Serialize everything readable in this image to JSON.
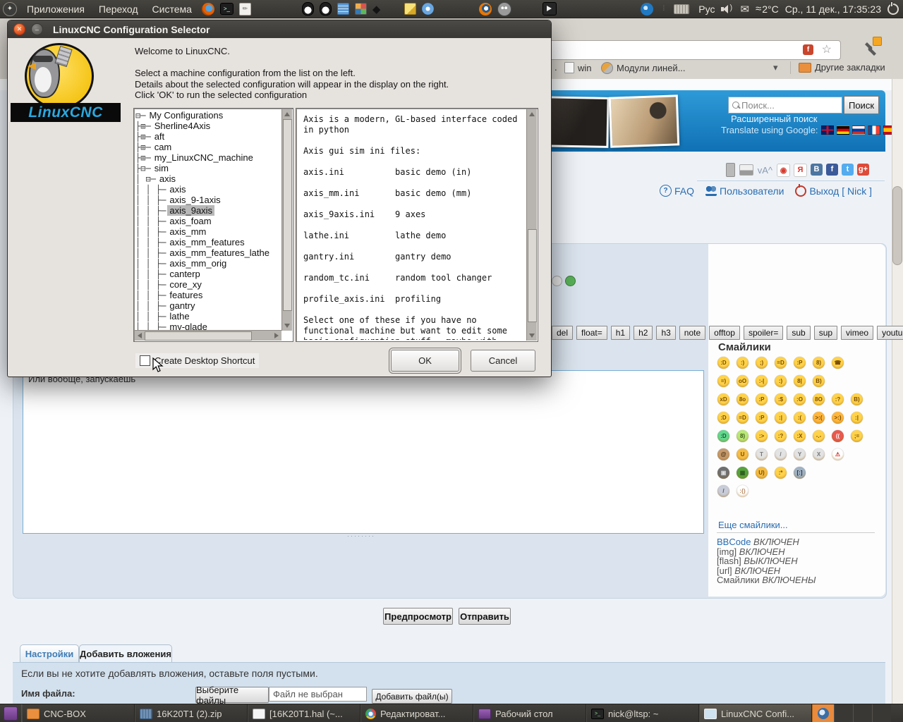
{
  "colors": {
    "accent_blue": "#1071b4",
    "link_blue": "#2a6db0",
    "panel_dark": "#3c3b37",
    "selection_gray": "#b8b8b8"
  },
  "icons": {
    "star": "☆",
    "caret": "▾",
    "envelope": "✉",
    "approx": "≈",
    "inkscape_diamond": "◆",
    "dots": "⁞",
    "text_size": "vA^",
    "question": "?",
    "flash": "f",
    "terminal_prompt": ">_",
    "gedit_pencil": "✏",
    "distro": "✦",
    "bookmarks_dot": "."
  },
  "top_panel": {
    "menus": [
      "Приложения",
      "Переход",
      "Система"
    ],
    "lang": "Рус",
    "temp": "2°C",
    "clock": "Ср., 11 дек., 17:35:23"
  },
  "dialog": {
    "title": "LinuxCNC Configuration Selector",
    "logo_text": "LinuxCNC",
    "welcome_lines": [
      "Welcome to LinuxCNC.",
      "",
      "Select a machine configuration from the list on the left.",
      "Details about the selected configuration will appear in the display on the right.",
      "Click 'OK' to run the selected configuration"
    ],
    "tree": [
      {
        "p": "⊟─",
        "label": "My Configurations",
        "sel": false
      },
      {
        "p": "├⊞─",
        "label": "Sherline4Axis",
        "sel": false
      },
      {
        "p": "├⊞─",
        "label": "aft",
        "sel": false
      },
      {
        "p": "├⊞─",
        "label": "cam",
        "sel": false
      },
      {
        "p": "├⊞─",
        "label": "my_LinuxCNC_machine",
        "sel": false
      },
      {
        "p": "├⊟─",
        "label": "sim",
        "sel": false
      },
      {
        "p": "│ ⊟─",
        "label": "axis",
        "sel": false
      },
      {
        "p": "│ │ ├─",
        "label": "axis",
        "sel": false
      },
      {
        "p": "│ │ ├─",
        "label": "axis_9-1axis",
        "sel": false
      },
      {
        "p": "│ │ ├─",
        "label": "axis_9axis",
        "sel": true
      },
      {
        "p": "│ │ ├─",
        "label": "axis_foam",
        "sel": false
      },
      {
        "p": "│ │ ├─",
        "label": "axis_mm",
        "sel": false
      },
      {
        "p": "│ │ ├─",
        "label": "axis_mm_features",
        "sel": false
      },
      {
        "p": "│ │ ├─",
        "label": "axis_mm_features_lathe",
        "sel": false
      },
      {
        "p": "│ │ ├─",
        "label": "axis_mm_orig",
        "sel": false
      },
      {
        "p": "│ │ ├─",
        "label": "canterp",
        "sel": false
      },
      {
        "p": "│ │ ├─",
        "label": "core_xy",
        "sel": false
      },
      {
        "p": "│ │ ├─",
        "label": "features",
        "sel": false
      },
      {
        "p": "│ │ ├─",
        "label": "gantry",
        "sel": false
      },
      {
        "p": "│ │ ├─",
        "label": "lathe",
        "sel": false
      },
      {
        "p": "│ │ ├─",
        "label": "my-glade",
        "sel": false
      }
    ],
    "info_text": "Axis is a modern, GL-based interface coded\nin python\n\nAxis gui sim ini files:\n\naxis.ini          basic demo (in)\n\naxis_mm.ini       basic demo (mm)\n\naxis_9axis.ini    9 axes\n\nlathe.ini         lathe demo\n\ngantry.ini        gantry demo\n\nrandom_tc.ini     random tool changer\n\nprofile_axis.ini  profiling\n\nSelect one of these if you have no\nfunctional machine but want to edit some\nbasic configuration stuff...maybe with",
    "checkbox_label": "Create Desktop Shortcut",
    "ok_label": "OK",
    "cancel_label": "Cancel"
  },
  "browser": {
    "bookmarks": {
      "dot": ".",
      "win": "win",
      "modules": "Модули линей...",
      "other": "Другие закладки"
    },
    "search_placeholder": "Поиск...",
    "search_button": "Поиск",
    "advanced_search": "Расширенный поиск",
    "translate_label": "Translate using Google:",
    "flags": [
      "uk",
      "de",
      "ru",
      "fr",
      "es"
    ],
    "text_size_control": "vA^",
    "social_icons": [
      {
        "name": "audio",
        "t": "◉",
        "c": "#ffffff",
        "fg": "#d43b2f",
        "border": "#c9c9c9"
      },
      {
        "name": "yandex",
        "t": "Я",
        "c": "#ffffff",
        "fg": "#e0352b",
        "border": "#c9c9c9"
      },
      {
        "name": "vk",
        "t": "В",
        "c": "#4d76a1",
        "fg": "#ffffff"
      },
      {
        "name": "facebook",
        "t": "f",
        "c": "#3c5a99",
        "fg": "#ffffff"
      },
      {
        "name": "twitter",
        "t": "t",
        "c": "#55acee",
        "fg": "#ffffff"
      },
      {
        "name": "gplus",
        "t": "g+",
        "c": "#dd4b39",
        "fg": "#ffffff"
      }
    ],
    "nav": {
      "faq": "FAQ",
      "users": "Пользователи",
      "logout": "Выход [ Nick ]"
    },
    "bbcode_buttons": [
      "del",
      "float=",
      "h1",
      "h2",
      "h3",
      "note",
      "offtop",
      "spoiler=",
      "sub",
      "sup",
      "vimeo",
      "youtube"
    ],
    "textarea_text": "Или вообще, запускаешь",
    "smilies_title": "Смайлики",
    "smilies_rows": [
      [
        {
          "f": ":D"
        },
        {
          "f": ":)"
        },
        {
          "f": ";)"
        },
        {
          "f": "=D"
        },
        {
          "f": ":P"
        },
        {
          "f": "8)"
        },
        {
          "f": "☎"
        }
      ],
      [
        {
          "f": "=)"
        },
        {
          "f": "oO"
        },
        {
          "f": ":-|"
        },
        {
          "f": ":)"
        },
        {
          "f": "8|"
        },
        {
          "f": "B)"
        }
      ],
      [
        {
          "f": "xD"
        },
        {
          "f": "8o"
        },
        {
          "f": ":P"
        },
        {
          "f": ":$"
        },
        {
          "f": ":O"
        },
        {
          "f": "8O"
        },
        {
          "f": ":?"
        },
        {
          "f": "B)"
        }
      ],
      [
        {
          "f": ":D"
        },
        {
          "f": "=D"
        },
        {
          "f": ":P"
        },
        {
          "f": ":|"
        },
        {
          "f": ":("
        },
        {
          "f": ">:(",
          "c": "#ffb63c"
        },
        {
          "f": ">:)",
          "c": "#ffb63c"
        },
        {
          "f": ":|"
        }
      ],
      [
        {
          "f": ":D",
          "c": "#63d88e",
          "fg": "#155b32"
        },
        {
          "f": "8)",
          "c": "#b9e877",
          "fg": "#3a5b15"
        },
        {
          "f": ":>"
        },
        {
          "f": ":?"
        },
        {
          "f": ":X"
        },
        {
          "f": "-.-"
        },
        {
          "f": "((",
          "c": "#e85a4f",
          "fg": "#fff"
        },
        {
          "f": ";="
        }
      ],
      [
        {
          "f": "@",
          "c": "#c59a6d",
          "fg": "#4a2d10"
        },
        {
          "f": "U",
          "c": "#f4bd45"
        },
        {
          "f": "T",
          "c": "#e3e3e3",
          "fg": "#777"
        },
        {
          "f": "/",
          "c": "#e3e3e3",
          "fg": "#777"
        },
        {
          "f": "Y",
          "c": "#e3e3e3",
          "fg": "#777"
        },
        {
          "f": "X",
          "c": "#e3e3e3",
          "fg": "#777"
        },
        {
          "f": "⚠",
          "c": "#ffffff",
          "fg": "#d42b1e"
        }
      ],
      [
        {
          "f": "▣",
          "c": "#6f6f6f",
          "fg": "#ddd"
        },
        {
          "f": "▦",
          "c": "#57a33c",
          "fg": "#2c5b1e"
        },
        {
          "f": "U)",
          "c": "#f4bd45"
        },
        {
          "f": ":*"
        },
        {
          "f": "[:]",
          "c": "#9fb2c4",
          "fg": "#333"
        }
      ],
      [
        {
          "f": "/",
          "c": "#c8ccd8",
          "fg": "#555"
        },
        {
          "f": ":{)",
          "c": "#ffffff",
          "fg": "#b88860"
        }
      ]
    ],
    "more_smilies": "Еще смайлики...",
    "bbcode_status": [
      {
        "label": "BBCode",
        "status": "ВКЛЮЧЕН",
        "link": true
      },
      {
        "label": "[img]",
        "status": "ВКЛЮЧЕН",
        "link": false
      },
      {
        "label": "[flash]",
        "status": "ВЫКЛЮЧЕН",
        "link": false
      },
      {
        "label": "[url]",
        "status": "ВКЛЮЧЕН",
        "link": false
      },
      {
        "label": "Смайлики",
        "status": "ВКЛЮЧЕНЫ",
        "link": false
      }
    ],
    "preview_button": "Предпросмотр",
    "submit_button": "Отправить",
    "tabs": [
      "Настройки",
      "Добавить вложения"
    ],
    "attach_note": "Если вы не хотите добавлять вложения, оставьте поля пустыми.",
    "filename_label": "Имя файла:",
    "choose_files": "Выберите файлы",
    "no_file": "Файл не выбран",
    "add_files": "Добавить файл(ы)"
  },
  "taskbar": {
    "items": [
      {
        "icon": "folder",
        "label": "CNC-BOX",
        "active": false
      },
      {
        "icon": "archive",
        "label": "16K20T1 (2).zip",
        "active": false
      },
      {
        "icon": "editor",
        "label": "[16K20T1.hal (~...",
        "active": false
      },
      {
        "icon": "chrome",
        "label": "Редактироват...",
        "active": false
      },
      {
        "icon": "desktop",
        "label": "Рабочий стол",
        "active": false
      },
      {
        "icon": "terminal",
        "label": "nick@ltsp: ~",
        "active": false
      },
      {
        "icon": "window",
        "label": "LinuxCNC Confi...",
        "active": true
      }
    ]
  }
}
